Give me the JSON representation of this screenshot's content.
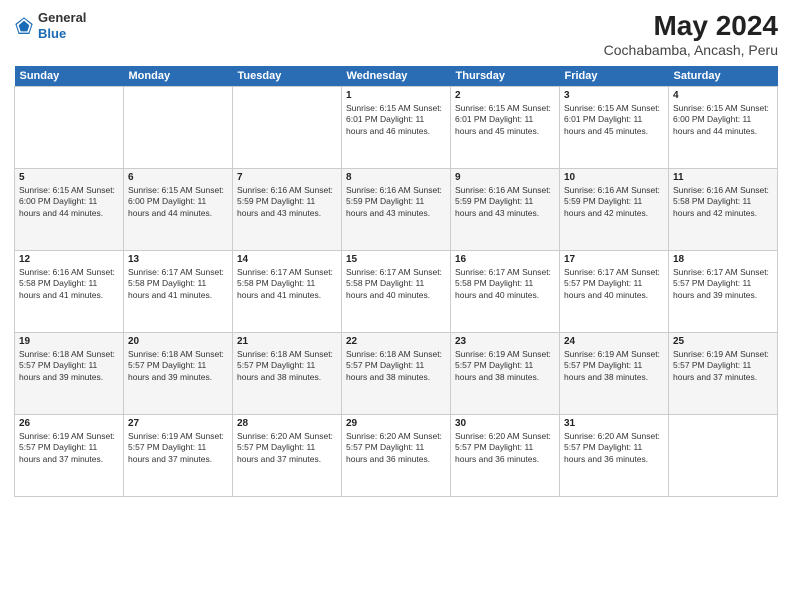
{
  "logo": {
    "general": "General",
    "blue": "Blue"
  },
  "title": "May 2024",
  "subtitle": "Cochabamba, Ancash, Peru",
  "days_of_week": [
    "Sunday",
    "Monday",
    "Tuesday",
    "Wednesday",
    "Thursday",
    "Friday",
    "Saturday"
  ],
  "weeks": [
    [
      {
        "day": "",
        "info": ""
      },
      {
        "day": "",
        "info": ""
      },
      {
        "day": "",
        "info": ""
      },
      {
        "day": "1",
        "info": "Sunrise: 6:15 AM\nSunset: 6:01 PM\nDaylight: 11 hours\nand 46 minutes."
      },
      {
        "day": "2",
        "info": "Sunrise: 6:15 AM\nSunset: 6:01 PM\nDaylight: 11 hours\nand 45 minutes."
      },
      {
        "day": "3",
        "info": "Sunrise: 6:15 AM\nSunset: 6:01 PM\nDaylight: 11 hours\nand 45 minutes."
      },
      {
        "day": "4",
        "info": "Sunrise: 6:15 AM\nSunset: 6:00 PM\nDaylight: 11 hours\nand 44 minutes."
      }
    ],
    [
      {
        "day": "5",
        "info": "Sunrise: 6:15 AM\nSunset: 6:00 PM\nDaylight: 11 hours\nand 44 minutes."
      },
      {
        "day": "6",
        "info": "Sunrise: 6:15 AM\nSunset: 6:00 PM\nDaylight: 11 hours\nand 44 minutes."
      },
      {
        "day": "7",
        "info": "Sunrise: 6:16 AM\nSunset: 5:59 PM\nDaylight: 11 hours\nand 43 minutes."
      },
      {
        "day": "8",
        "info": "Sunrise: 6:16 AM\nSunset: 5:59 PM\nDaylight: 11 hours\nand 43 minutes."
      },
      {
        "day": "9",
        "info": "Sunrise: 6:16 AM\nSunset: 5:59 PM\nDaylight: 11 hours\nand 43 minutes."
      },
      {
        "day": "10",
        "info": "Sunrise: 6:16 AM\nSunset: 5:59 PM\nDaylight: 11 hours\nand 42 minutes."
      },
      {
        "day": "11",
        "info": "Sunrise: 6:16 AM\nSunset: 5:58 PM\nDaylight: 11 hours\nand 42 minutes."
      }
    ],
    [
      {
        "day": "12",
        "info": "Sunrise: 6:16 AM\nSunset: 5:58 PM\nDaylight: 11 hours\nand 41 minutes."
      },
      {
        "day": "13",
        "info": "Sunrise: 6:17 AM\nSunset: 5:58 PM\nDaylight: 11 hours\nand 41 minutes."
      },
      {
        "day": "14",
        "info": "Sunrise: 6:17 AM\nSunset: 5:58 PM\nDaylight: 11 hours\nand 41 minutes."
      },
      {
        "day": "15",
        "info": "Sunrise: 6:17 AM\nSunset: 5:58 PM\nDaylight: 11 hours\nand 40 minutes."
      },
      {
        "day": "16",
        "info": "Sunrise: 6:17 AM\nSunset: 5:58 PM\nDaylight: 11 hours\nand 40 minutes."
      },
      {
        "day": "17",
        "info": "Sunrise: 6:17 AM\nSunset: 5:57 PM\nDaylight: 11 hours\nand 40 minutes."
      },
      {
        "day": "18",
        "info": "Sunrise: 6:17 AM\nSunset: 5:57 PM\nDaylight: 11 hours\nand 39 minutes."
      }
    ],
    [
      {
        "day": "19",
        "info": "Sunrise: 6:18 AM\nSunset: 5:57 PM\nDaylight: 11 hours\nand 39 minutes."
      },
      {
        "day": "20",
        "info": "Sunrise: 6:18 AM\nSunset: 5:57 PM\nDaylight: 11 hours\nand 39 minutes."
      },
      {
        "day": "21",
        "info": "Sunrise: 6:18 AM\nSunset: 5:57 PM\nDaylight: 11 hours\nand 38 minutes."
      },
      {
        "day": "22",
        "info": "Sunrise: 6:18 AM\nSunset: 5:57 PM\nDaylight: 11 hours\nand 38 minutes."
      },
      {
        "day": "23",
        "info": "Sunrise: 6:19 AM\nSunset: 5:57 PM\nDaylight: 11 hours\nand 38 minutes."
      },
      {
        "day": "24",
        "info": "Sunrise: 6:19 AM\nSunset: 5:57 PM\nDaylight: 11 hours\nand 38 minutes."
      },
      {
        "day": "25",
        "info": "Sunrise: 6:19 AM\nSunset: 5:57 PM\nDaylight: 11 hours\nand 37 minutes."
      }
    ],
    [
      {
        "day": "26",
        "info": "Sunrise: 6:19 AM\nSunset: 5:57 PM\nDaylight: 11 hours\nand 37 minutes."
      },
      {
        "day": "27",
        "info": "Sunrise: 6:19 AM\nSunset: 5:57 PM\nDaylight: 11 hours\nand 37 minutes."
      },
      {
        "day": "28",
        "info": "Sunrise: 6:20 AM\nSunset: 5:57 PM\nDaylight: 11 hours\nand 37 minutes."
      },
      {
        "day": "29",
        "info": "Sunrise: 6:20 AM\nSunset: 5:57 PM\nDaylight: 11 hours\nand 36 minutes."
      },
      {
        "day": "30",
        "info": "Sunrise: 6:20 AM\nSunset: 5:57 PM\nDaylight: 11 hours\nand 36 minutes."
      },
      {
        "day": "31",
        "info": "Sunrise: 6:20 AM\nSunset: 5:57 PM\nDaylight: 11 hours\nand 36 minutes."
      },
      {
        "day": "",
        "info": ""
      }
    ]
  ]
}
